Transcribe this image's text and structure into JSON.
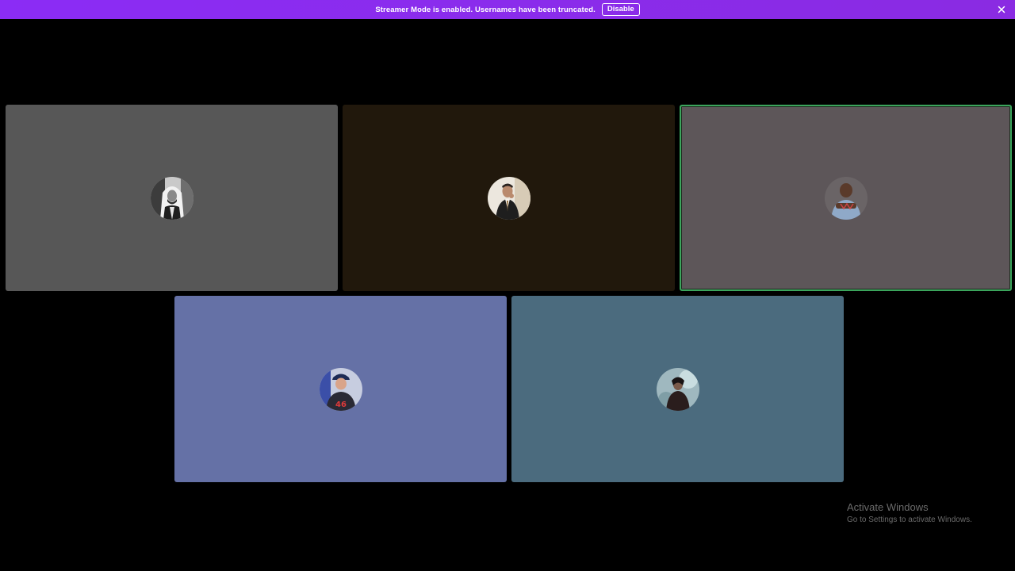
{
  "notice": {
    "text": "Streamer Mode is enabled. Usernames have been truncated.",
    "button_label": "Disable",
    "background": "#8a2be2",
    "close_icon": "close-icon"
  },
  "participants": [
    {
      "tile_color": "#575757",
      "speaking": false,
      "avatar_icon": "avatar-man-white-headdress"
    },
    {
      "tile_color": "#21180c",
      "speaking": false,
      "avatar_icon": "avatar-man-suit"
    },
    {
      "tile_color": "#5d5659",
      "speaking": true,
      "avatar_icon": "avatar-man-blue-shirt"
    },
    {
      "tile_color": "#6571a6",
      "speaking": false,
      "avatar_icon": "avatar-man-cap-jersey"
    },
    {
      "tile_color": "#4b6b7e",
      "speaking": false,
      "avatar_icon": "avatar-person-dark-cloak"
    }
  ],
  "speaking_border_color": "#3ba55c",
  "watermark": {
    "title": "Activate Windows",
    "subtitle": "Go to Settings to activate Windows."
  }
}
